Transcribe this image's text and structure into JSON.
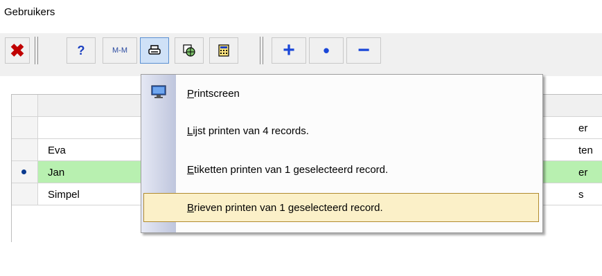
{
  "window": {
    "title": "Gebruikers"
  },
  "toolbar": {
    "buttons": [
      {
        "name": "close",
        "icon": "close-x-icon",
        "glyph": "✖",
        "color": "#c00000"
      },
      {
        "name": "help",
        "icon": "help-icon",
        "glyph": "?",
        "color": "#1a3fc0"
      },
      {
        "name": "mm",
        "icon": "mm-icon",
        "label": "M-M",
        "color": "#2a4aa0"
      },
      {
        "name": "print",
        "icon": "printer-icon",
        "glyph": "🖶",
        "color": "#000000",
        "pressed": true
      },
      {
        "name": "export",
        "icon": "web-export-icon",
        "glyph": "🌐",
        "color": "#2a7a2a"
      },
      {
        "name": "calc",
        "icon": "calculator-icon",
        "glyph": "▦",
        "color": "#1a3fc0"
      },
      {
        "name": "add",
        "icon": "plus-icon",
        "glyph": "+",
        "color": "#1a47d8"
      },
      {
        "name": "current",
        "icon": "dot-icon",
        "glyph": "•",
        "color": "#1a47d8"
      },
      {
        "name": "delete",
        "icon": "minus-icon",
        "glyph": "−",
        "color": "#1a47d8"
      }
    ]
  },
  "grid": {
    "rows": [
      {
        "name": "",
        "right": "er"
      },
      {
        "name": "Eva",
        "right": "ten"
      },
      {
        "name": "Jan",
        "right": "er",
        "selected": true
      },
      {
        "name": "Simpel",
        "right": "s"
      }
    ]
  },
  "print_menu": {
    "items": [
      {
        "accel": "P",
        "rest": "rintscreen",
        "icon": "monitor-icon"
      },
      {
        "accel": "L",
        "rest": "ijst printen van 4 records."
      },
      {
        "accel": "E",
        "rest": "tiketten printen van 1 geselecteerd record."
      },
      {
        "accel": "B",
        "rest": "rieven printen van 1 geselecteerd record.",
        "highlighted": true
      }
    ]
  },
  "colors": {
    "selected_row": "#b8f0b0",
    "menu_highlight": "#fbf0c8",
    "menu_highlight_border": "#b08a2e"
  }
}
